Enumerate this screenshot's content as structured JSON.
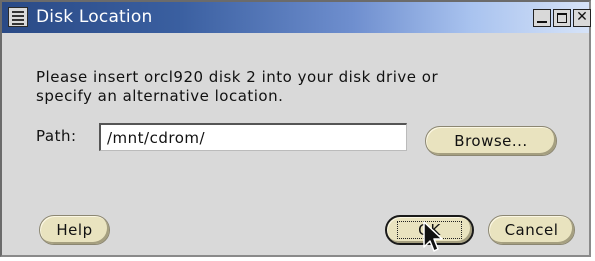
{
  "window": {
    "title": "Disk Location"
  },
  "message": {
    "line1": "Please insert orcl920 disk 2 into your disk drive or",
    "line2": "specify an alternative location."
  },
  "path": {
    "label": "Path:",
    "value": "/mnt/cdrom/"
  },
  "buttons": {
    "browse": "Browse...",
    "help": "Help",
    "ok": "OK",
    "cancel": "Cancel"
  },
  "titlebar_icons": {
    "system": "window-menu-icon",
    "minimize": "minimize-icon",
    "maximize": "maximize-icon",
    "close": "close-icon"
  },
  "colors": {
    "titlebar_start": "#2a4a86",
    "titlebar_end": "#d6e3f8",
    "dialog_bg": "#d9d9d9",
    "button_bg": "#e9e3bf"
  }
}
